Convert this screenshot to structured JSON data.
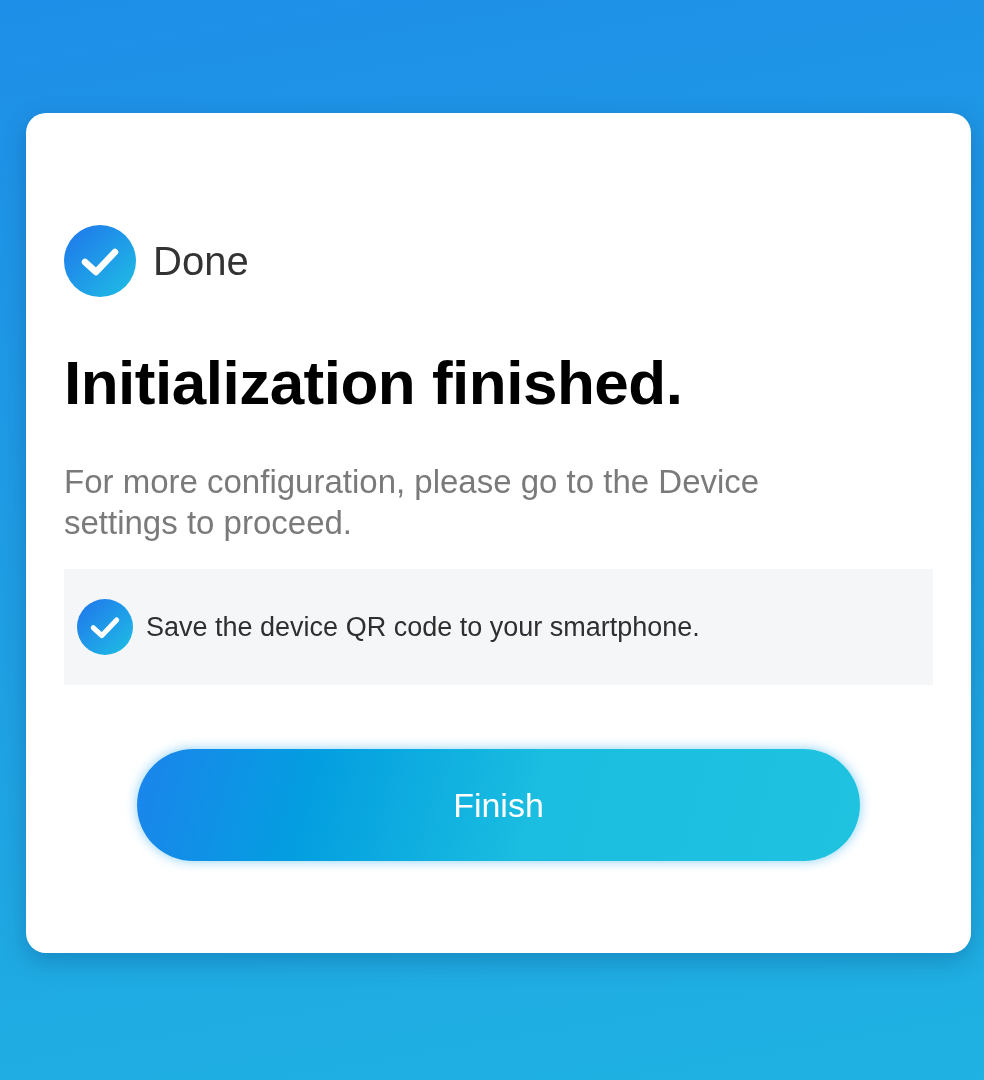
{
  "status": {
    "label": "Done"
  },
  "title": "Initialization finished.",
  "description": "For more configuration, please go to the Device settings to proceed.",
  "save_qr_option": {
    "label": "Save the device QR code to your smartphone.",
    "checked": true
  },
  "finish_button": {
    "label": "Finish"
  }
}
